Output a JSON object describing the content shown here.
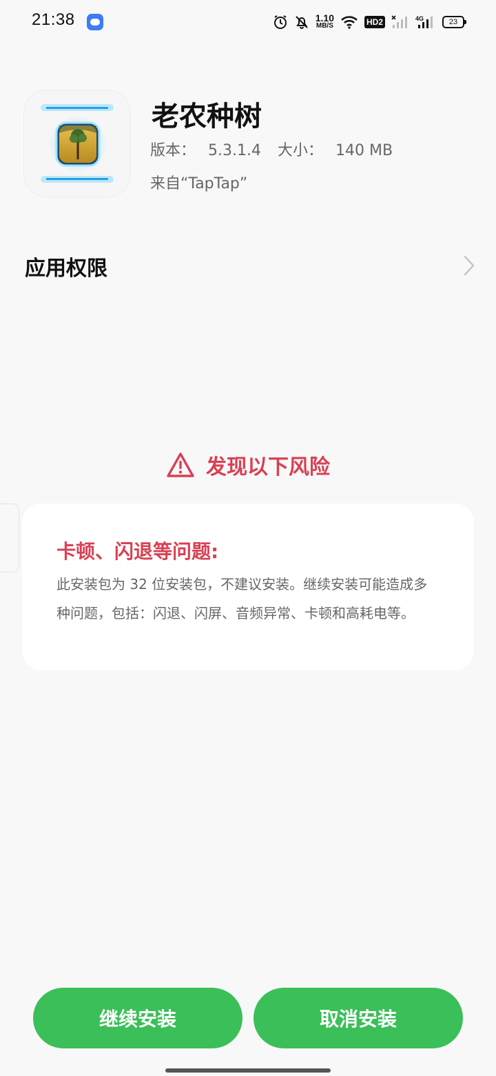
{
  "status_bar": {
    "time": "21:38",
    "net_speed_value": "1.10",
    "net_speed_unit": "MB/S",
    "hd_label": "HD2",
    "network_type": "4G",
    "battery_level": "23",
    "icons": [
      "app-notification-icon",
      "alarm-icon",
      "mute-bell-icon",
      "wifi-icon",
      "hd-icon",
      "signal-sim1-icon",
      "signal-4g-icon",
      "battery-icon"
    ]
  },
  "app": {
    "name": "老农种树",
    "version_label": "版本：",
    "version": "5.3.1.4",
    "size_label": "大小：",
    "size": "140 MB",
    "source_text": "来自“TapTap”",
    "icon": "farmer-tree-app-icon"
  },
  "permissions": {
    "label": "应用权限",
    "icon": "chevron-right-icon"
  },
  "risk": {
    "header": "发现以下风险",
    "icon": "warning-triangle-icon",
    "color": "#d94053",
    "card_title": "卡顿、闪退等问题:",
    "card_body": "此安装包为 32 位安装包，不建议安装。继续安装可能造成多种问题，包括：闪退、闪屏、音频异常、卡顿和高耗电等。"
  },
  "actions": {
    "continue_label": "继续安装",
    "cancel_label": "取消安装",
    "button_color": "#3bbf58"
  }
}
